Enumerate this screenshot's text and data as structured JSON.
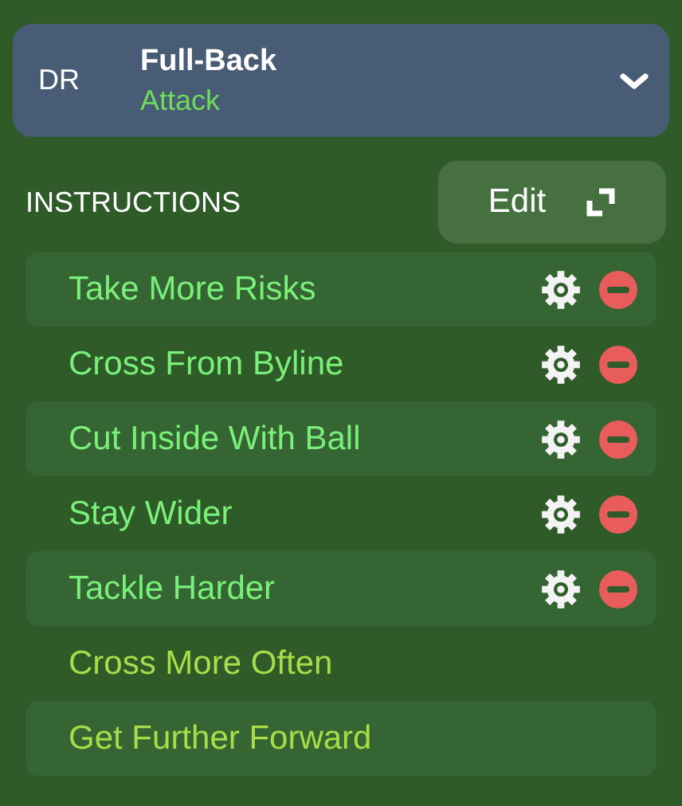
{
  "position": {
    "code": "DR",
    "role": "Full-Back",
    "duty": "Attack"
  },
  "section_title": "INSTRUCTIONS",
  "edit_button": "Edit",
  "instructions": [
    {
      "label": "Take More Risks",
      "kind": "active"
    },
    {
      "label": "Cross From Byline",
      "kind": "active"
    },
    {
      "label": "Cut Inside With Ball",
      "kind": "active"
    },
    {
      "label": "Stay Wider",
      "kind": "active"
    },
    {
      "label": "Tackle Harder",
      "kind": "active"
    },
    {
      "label": "Cross More Often",
      "kind": "suggested"
    },
    {
      "label": "Get Further Forward",
      "kind": "suggested"
    }
  ]
}
